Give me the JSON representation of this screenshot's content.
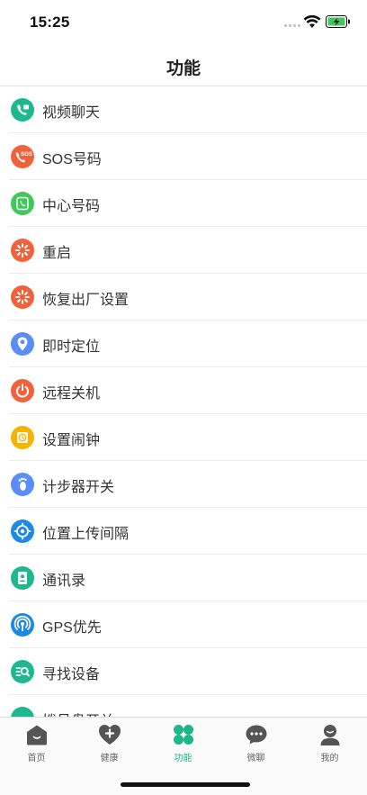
{
  "status_bar": {
    "time": "15:25"
  },
  "nav": {
    "title": "功能"
  },
  "colors": {
    "accent": "#1db58a",
    "text": "#333333",
    "divider": "#ececec",
    "tab_inactive": "#666666"
  },
  "features": [
    {
      "label": "视频聊天",
      "icon": "video-call-icon",
      "color": "#1fb88e"
    },
    {
      "label": "SOS号码",
      "icon": "sos-icon",
      "color": "#f0623c"
    },
    {
      "label": "中心号码",
      "icon": "center-phone-icon",
      "color": "#3ec95a"
    },
    {
      "label": "重启",
      "icon": "restart-icon",
      "color": "#f0623c"
    },
    {
      "label": "恢复出厂设置",
      "icon": "factory-reset-icon",
      "color": "#f0623c"
    },
    {
      "label": "即时定位",
      "icon": "location-pin-icon",
      "color": "#5b8df6"
    },
    {
      "label": "远程关机",
      "icon": "power-off-icon",
      "color": "#f0623c"
    },
    {
      "label": "设置闹钟",
      "icon": "alarm-clock-icon",
      "color": "#f5b400"
    },
    {
      "label": "计步器开关",
      "icon": "footprint-icon",
      "color": "#5b8df6"
    },
    {
      "label": "位置上传间隔",
      "icon": "crosshair-icon",
      "color": "#1e88e5"
    },
    {
      "label": "通讯录",
      "icon": "contacts-icon",
      "color": "#1fb88e"
    },
    {
      "label": "GPS优先",
      "icon": "gps-signal-icon",
      "color": "#1e88e5"
    },
    {
      "label": "寻找设备",
      "icon": "find-device-icon",
      "color": "#1fb88e"
    },
    {
      "label": "拨号盘开关",
      "icon": "dialpad-icon",
      "color": "#1fb88e"
    }
  ],
  "tabs": [
    {
      "label": "首页",
      "icon": "home-icon",
      "active": false
    },
    {
      "label": "健康",
      "icon": "health-heart-icon",
      "active": false
    },
    {
      "label": "功能",
      "icon": "clover-icon",
      "active": true
    },
    {
      "label": "微聊",
      "icon": "chat-bubble-icon",
      "active": false
    },
    {
      "label": "我的",
      "icon": "profile-icon",
      "active": false
    }
  ]
}
